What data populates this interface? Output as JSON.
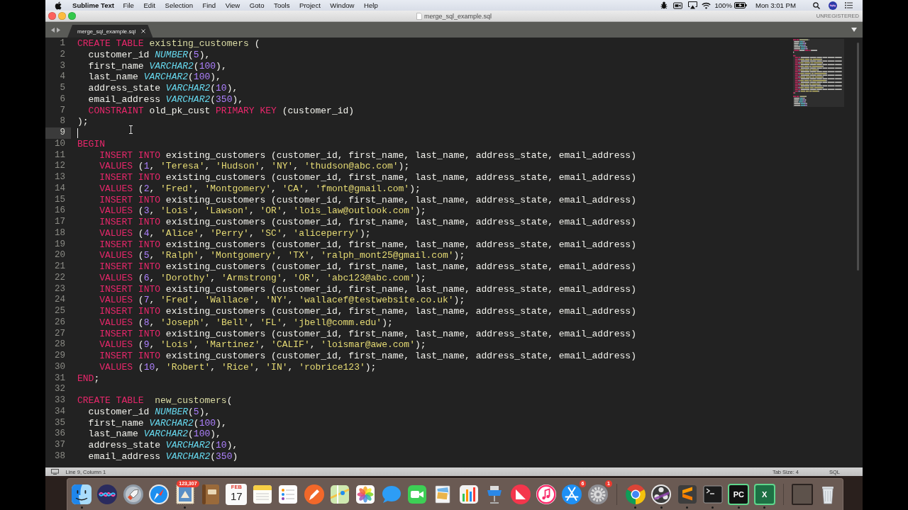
{
  "menu_bar": {
    "app_name": "Sublime Text",
    "menus": [
      "File",
      "Edit",
      "Selection",
      "Find",
      "View",
      "Goto",
      "Tools",
      "Project",
      "Window",
      "Help"
    ],
    "battery_percent": "100%",
    "clock": "Mon 3:01 PM"
  },
  "window": {
    "title": "merge_sql_example.sql",
    "license": "UNREGISTERED"
  },
  "tabs": [
    {
      "label": "merge_sql_example.sql",
      "selected": true
    }
  ],
  "editor": {
    "lines": [
      {
        "number": "1",
        "current": false,
        "tokens": [
          {
            "kind": "keyword",
            "text": "CREATE "
          },
          {
            "kind": "keyword",
            "text": "TABLE "
          },
          {
            "kind": "name",
            "text": "existing_customers"
          },
          {
            "kind": "plain",
            "text": " ("
          }
        ]
      },
      {
        "number": "2",
        "current": false,
        "tokens": [
          {
            "kind": "plain",
            "text": "  customer_id "
          },
          {
            "kind": "type",
            "text": "NUMBER"
          },
          {
            "kind": "plain",
            "text": "("
          },
          {
            "kind": "number",
            "text": "5"
          },
          {
            "kind": "plain",
            "text": "),"
          }
        ]
      },
      {
        "number": "3",
        "current": false,
        "tokens": [
          {
            "kind": "plain",
            "text": "  first_name "
          },
          {
            "kind": "type",
            "text": "VARCHAR2"
          },
          {
            "kind": "plain",
            "text": "("
          },
          {
            "kind": "number",
            "text": "100"
          },
          {
            "kind": "plain",
            "text": "),"
          }
        ]
      },
      {
        "number": "4",
        "current": false,
        "tokens": [
          {
            "kind": "plain",
            "text": "  last_name "
          },
          {
            "kind": "type",
            "text": "VARCHAR2"
          },
          {
            "kind": "plain",
            "text": "("
          },
          {
            "kind": "number",
            "text": "100"
          },
          {
            "kind": "plain",
            "text": "),"
          }
        ]
      },
      {
        "number": "5",
        "current": false,
        "tokens": [
          {
            "kind": "plain",
            "text": "  address_state "
          },
          {
            "kind": "type",
            "text": "VARCHAR2"
          },
          {
            "kind": "plain",
            "text": "("
          },
          {
            "kind": "number",
            "text": "10"
          },
          {
            "kind": "plain",
            "text": "),"
          }
        ]
      },
      {
        "number": "6",
        "current": false,
        "tokens": [
          {
            "kind": "plain",
            "text": "  email_address "
          },
          {
            "kind": "type",
            "text": "VARCHAR2"
          },
          {
            "kind": "plain",
            "text": "("
          },
          {
            "kind": "number",
            "text": "350"
          },
          {
            "kind": "plain",
            "text": "),"
          }
        ]
      },
      {
        "number": "7",
        "current": false,
        "tokens": [
          {
            "kind": "keyword",
            "text": "  CONSTRAINT"
          },
          {
            "kind": "plain",
            "text": " old_pk_cust "
          },
          {
            "kind": "keyword",
            "text": "PRIMARY "
          },
          {
            "kind": "keyword",
            "text": "KEY"
          },
          {
            "kind": "plain",
            "text": " (customer_id)"
          }
        ]
      },
      {
        "number": "8",
        "current": false,
        "tokens": [
          {
            "kind": "plain",
            "text": ");"
          }
        ]
      },
      {
        "number": "9",
        "current": true
      },
      {
        "number": "10",
        "current": false,
        "tokens": [
          {
            "kind": "keyword",
            "text": "BEGIN"
          }
        ]
      },
      {
        "number": "11",
        "current": false,
        "tokens": [
          {
            "kind": "keyword",
            "text": "    INSERT "
          },
          {
            "kind": "keyword",
            "text": "INTO"
          },
          {
            "kind": "plain",
            "text": " existing_customers (customer_id, first_name, last_name, address_state, email_address)"
          }
        ]
      },
      {
        "number": "12",
        "current": false,
        "tokens": [
          {
            "kind": "keyword",
            "text": "    VALUES"
          },
          {
            "kind": "plain",
            "text": " ("
          },
          {
            "kind": "number",
            "text": "1"
          },
          {
            "kind": "plain",
            "text": ", "
          },
          {
            "kind": "string",
            "text": "'Teresa'"
          },
          {
            "kind": "plain",
            "text": ", "
          },
          {
            "kind": "string",
            "text": "'Hudson'"
          },
          {
            "kind": "plain",
            "text": ", "
          },
          {
            "kind": "string",
            "text": "'NY'"
          },
          {
            "kind": "plain",
            "text": ", "
          },
          {
            "kind": "string",
            "text": "'thudson@abc.com'"
          },
          {
            "kind": "plain",
            "text": ");"
          }
        ]
      },
      {
        "number": "13",
        "current": false,
        "tokens": [
          {
            "kind": "keyword",
            "text": "    INSERT "
          },
          {
            "kind": "keyword",
            "text": "INTO"
          },
          {
            "kind": "plain",
            "text": " existing_customers (customer_id, first_name, last_name, address_state, email_address)"
          }
        ]
      },
      {
        "number": "14",
        "current": false,
        "tokens": [
          {
            "kind": "keyword",
            "text": "    VALUES"
          },
          {
            "kind": "plain",
            "text": " ("
          },
          {
            "kind": "number",
            "text": "2"
          },
          {
            "kind": "plain",
            "text": ", "
          },
          {
            "kind": "string",
            "text": "'Fred'"
          },
          {
            "kind": "plain",
            "text": ", "
          },
          {
            "kind": "string",
            "text": "'Montgomery'"
          },
          {
            "kind": "plain",
            "text": ", "
          },
          {
            "kind": "string",
            "text": "'CA'"
          },
          {
            "kind": "plain",
            "text": ", "
          },
          {
            "kind": "string",
            "text": "'fmont@gmail.com'"
          },
          {
            "kind": "plain",
            "text": ");"
          }
        ]
      },
      {
        "number": "15",
        "current": false,
        "tokens": [
          {
            "kind": "keyword",
            "text": "    INSERT "
          },
          {
            "kind": "keyword",
            "text": "INTO"
          },
          {
            "kind": "plain",
            "text": " existing_customers (customer_id, first_name, last_name, address_state, email_address)"
          }
        ]
      },
      {
        "number": "16",
        "current": false,
        "tokens": [
          {
            "kind": "keyword",
            "text": "    VALUES"
          },
          {
            "kind": "plain",
            "text": " ("
          },
          {
            "kind": "number",
            "text": "3"
          },
          {
            "kind": "plain",
            "text": ", "
          },
          {
            "kind": "string",
            "text": "'Lois'"
          },
          {
            "kind": "plain",
            "text": ", "
          },
          {
            "kind": "string",
            "text": "'Lawson'"
          },
          {
            "kind": "plain",
            "text": ", "
          },
          {
            "kind": "string",
            "text": "'OR'"
          },
          {
            "kind": "plain",
            "text": ", "
          },
          {
            "kind": "string",
            "text": "'lois_law@outlook.com'"
          },
          {
            "kind": "plain",
            "text": ");"
          }
        ]
      },
      {
        "number": "17",
        "current": false,
        "tokens": [
          {
            "kind": "keyword",
            "text": "    INSERT "
          },
          {
            "kind": "keyword",
            "text": "INTO"
          },
          {
            "kind": "plain",
            "text": " existing_customers (customer_id, first_name, last_name, address_state, email_address)"
          }
        ]
      },
      {
        "number": "18",
        "current": false,
        "tokens": [
          {
            "kind": "keyword",
            "text": "    VALUES"
          },
          {
            "kind": "plain",
            "text": " ("
          },
          {
            "kind": "number",
            "text": "4"
          },
          {
            "kind": "plain",
            "text": ", "
          },
          {
            "kind": "string",
            "text": "'Alice'"
          },
          {
            "kind": "plain",
            "text": ", "
          },
          {
            "kind": "string",
            "text": "'Perry'"
          },
          {
            "kind": "plain",
            "text": ", "
          },
          {
            "kind": "string",
            "text": "'SC'"
          },
          {
            "kind": "plain",
            "text": ", "
          },
          {
            "kind": "string",
            "text": "'aliceperry'"
          },
          {
            "kind": "plain",
            "text": ");"
          }
        ]
      },
      {
        "number": "19",
        "current": false,
        "tokens": [
          {
            "kind": "keyword",
            "text": "    INSERT "
          },
          {
            "kind": "keyword",
            "text": "INTO"
          },
          {
            "kind": "plain",
            "text": " existing_customers (customer_id, first_name, last_name, address_state, email_address)"
          }
        ]
      },
      {
        "number": "20",
        "current": false,
        "tokens": [
          {
            "kind": "keyword",
            "text": "    VALUES"
          },
          {
            "kind": "plain",
            "text": " ("
          },
          {
            "kind": "number",
            "text": "5"
          },
          {
            "kind": "plain",
            "text": ", "
          },
          {
            "kind": "string",
            "text": "'Ralph'"
          },
          {
            "kind": "plain",
            "text": ", "
          },
          {
            "kind": "string",
            "text": "'Montgomery'"
          },
          {
            "kind": "plain",
            "text": ", "
          },
          {
            "kind": "string",
            "text": "'TX'"
          },
          {
            "kind": "plain",
            "text": ", "
          },
          {
            "kind": "string",
            "text": "'ralph_mont25@gmail.com'"
          },
          {
            "kind": "plain",
            "text": ");"
          }
        ]
      },
      {
        "number": "21",
        "current": false,
        "tokens": [
          {
            "kind": "keyword",
            "text": "    INSERT "
          },
          {
            "kind": "keyword",
            "text": "INTO"
          },
          {
            "kind": "plain",
            "text": " existing_customers (customer_id, first_name, last_name, address_state, email_address)"
          }
        ]
      },
      {
        "number": "22",
        "current": false,
        "tokens": [
          {
            "kind": "keyword",
            "text": "    VALUES"
          },
          {
            "kind": "plain",
            "text": " ("
          },
          {
            "kind": "number",
            "text": "6"
          },
          {
            "kind": "plain",
            "text": ", "
          },
          {
            "kind": "string",
            "text": "'Dorothy'"
          },
          {
            "kind": "plain",
            "text": ", "
          },
          {
            "kind": "string",
            "text": "'Armstrong'"
          },
          {
            "kind": "plain",
            "text": ", "
          },
          {
            "kind": "string",
            "text": "'OR'"
          },
          {
            "kind": "plain",
            "text": ", "
          },
          {
            "kind": "string",
            "text": "'abc123@abc.com'"
          },
          {
            "kind": "plain",
            "text": ");"
          }
        ]
      },
      {
        "number": "23",
        "current": false,
        "tokens": [
          {
            "kind": "keyword",
            "text": "    INSERT "
          },
          {
            "kind": "keyword",
            "text": "INTO"
          },
          {
            "kind": "plain",
            "text": " existing_customers (customer_id, first_name, last_name, address_state, email_address)"
          }
        ]
      },
      {
        "number": "24",
        "current": false,
        "tokens": [
          {
            "kind": "keyword",
            "text": "    VALUES"
          },
          {
            "kind": "plain",
            "text": " ("
          },
          {
            "kind": "number",
            "text": "7"
          },
          {
            "kind": "plain",
            "text": ", "
          },
          {
            "kind": "string",
            "text": "'Fred'"
          },
          {
            "kind": "plain",
            "text": ", "
          },
          {
            "kind": "string",
            "text": "'Wallace'"
          },
          {
            "kind": "plain",
            "text": ", "
          },
          {
            "kind": "string",
            "text": "'NY'"
          },
          {
            "kind": "plain",
            "text": ", "
          },
          {
            "kind": "string",
            "text": "'wallacef@testwebsite.co.uk'"
          },
          {
            "kind": "plain",
            "text": ");"
          }
        ]
      },
      {
        "number": "25",
        "current": false,
        "tokens": [
          {
            "kind": "keyword",
            "text": "    INSERT "
          },
          {
            "kind": "keyword",
            "text": "INTO"
          },
          {
            "kind": "plain",
            "text": " existing_customers (customer_id, first_name, last_name, address_state, email_address)"
          }
        ]
      },
      {
        "number": "26",
        "current": false,
        "tokens": [
          {
            "kind": "keyword",
            "text": "    VALUES"
          },
          {
            "kind": "plain",
            "text": " ("
          },
          {
            "kind": "number",
            "text": "8"
          },
          {
            "kind": "plain",
            "text": ", "
          },
          {
            "kind": "string",
            "text": "'Joseph'"
          },
          {
            "kind": "plain",
            "text": ", "
          },
          {
            "kind": "string",
            "text": "'Bell'"
          },
          {
            "kind": "plain",
            "text": ", "
          },
          {
            "kind": "string",
            "text": "'FL'"
          },
          {
            "kind": "plain",
            "text": ", "
          },
          {
            "kind": "string",
            "text": "'jbell@comm.edu'"
          },
          {
            "kind": "plain",
            "text": ");"
          }
        ]
      },
      {
        "number": "27",
        "current": false,
        "tokens": [
          {
            "kind": "keyword",
            "text": "    INSERT "
          },
          {
            "kind": "keyword",
            "text": "INTO"
          },
          {
            "kind": "plain",
            "text": " existing_customers (customer_id, first_name, last_name, address_state, email_address)"
          }
        ]
      },
      {
        "number": "28",
        "current": false,
        "tokens": [
          {
            "kind": "keyword",
            "text": "    VALUES"
          },
          {
            "kind": "plain",
            "text": " ("
          },
          {
            "kind": "number",
            "text": "9"
          },
          {
            "kind": "plain",
            "text": ", "
          },
          {
            "kind": "string",
            "text": "'Lois'"
          },
          {
            "kind": "plain",
            "text": ", "
          },
          {
            "kind": "string",
            "text": "'Martinez'"
          },
          {
            "kind": "plain",
            "text": ", "
          },
          {
            "kind": "string",
            "text": "'CALIF'"
          },
          {
            "kind": "plain",
            "text": ", "
          },
          {
            "kind": "string",
            "text": "'loismar@awe.com'"
          },
          {
            "kind": "plain",
            "text": ");"
          }
        ]
      },
      {
        "number": "29",
        "current": false,
        "tokens": [
          {
            "kind": "keyword",
            "text": "    INSERT "
          },
          {
            "kind": "keyword",
            "text": "INTO"
          },
          {
            "kind": "plain",
            "text": " existing_customers (customer_id, first_name, last_name, address_state, email_address)"
          }
        ]
      },
      {
        "number": "30",
        "current": false,
        "tokens": [
          {
            "kind": "keyword",
            "text": "    VALUES"
          },
          {
            "kind": "plain",
            "text": " ("
          },
          {
            "kind": "number",
            "text": "10"
          },
          {
            "kind": "plain",
            "text": ", "
          },
          {
            "kind": "string",
            "text": "'Robert'"
          },
          {
            "kind": "plain",
            "text": ", "
          },
          {
            "kind": "string",
            "text": "'Rice'"
          },
          {
            "kind": "plain",
            "text": ", "
          },
          {
            "kind": "string",
            "text": "'IN'"
          },
          {
            "kind": "plain",
            "text": ", "
          },
          {
            "kind": "string",
            "text": "'robrice123'"
          },
          {
            "kind": "plain",
            "text": ");"
          }
        ]
      },
      {
        "number": "31",
        "current": false,
        "tokens": [
          {
            "kind": "keyword",
            "text": "END"
          },
          {
            "kind": "plain",
            "text": ";"
          }
        ]
      },
      {
        "number": "32",
        "current": false
      },
      {
        "number": "33",
        "current": false,
        "tokens": [
          {
            "kind": "keyword",
            "text": "CREATE "
          },
          {
            "kind": "keyword",
            "text": "TABLE  "
          },
          {
            "kind": "name",
            "text": "new_customers"
          },
          {
            "kind": "plain",
            "text": "("
          }
        ]
      },
      {
        "number": "34",
        "current": false,
        "tokens": [
          {
            "kind": "plain",
            "text": "  customer_id "
          },
          {
            "kind": "type",
            "text": "NUMBER"
          },
          {
            "kind": "plain",
            "text": "("
          },
          {
            "kind": "number",
            "text": "5"
          },
          {
            "kind": "plain",
            "text": "),"
          }
        ]
      },
      {
        "number": "35",
        "current": false,
        "tokens": [
          {
            "kind": "plain",
            "text": "  first_name "
          },
          {
            "kind": "type",
            "text": "VARCHAR2"
          },
          {
            "kind": "plain",
            "text": "("
          },
          {
            "kind": "number",
            "text": "100"
          },
          {
            "kind": "plain",
            "text": "),"
          }
        ]
      },
      {
        "number": "36",
        "current": false,
        "tokens": [
          {
            "kind": "plain",
            "text": "  last_name "
          },
          {
            "kind": "type",
            "text": "VARCHAR2"
          },
          {
            "kind": "plain",
            "text": "("
          },
          {
            "kind": "number",
            "text": "100"
          },
          {
            "kind": "plain",
            "text": "),"
          }
        ]
      },
      {
        "number": "37",
        "current": false,
        "tokens": [
          {
            "kind": "plain",
            "text": "  address_state "
          },
          {
            "kind": "type",
            "text": "VARCHAR2"
          },
          {
            "kind": "plain",
            "text": "("
          },
          {
            "kind": "number",
            "text": "10"
          },
          {
            "kind": "plain",
            "text": "),"
          }
        ]
      },
      {
        "number": "38",
        "current": false,
        "tokens": [
          {
            "kind": "plain",
            "text": "  email_address "
          },
          {
            "kind": "type",
            "text": "VARCHAR2"
          },
          {
            "kind": "plain",
            "text": "("
          },
          {
            "kind": "number",
            "text": "350"
          },
          {
            "kind": "plain",
            "text": ")"
          }
        ]
      }
    ]
  },
  "status_bar": {
    "position": "Line 9, Column 1",
    "tab_size": "Tab Size: 4",
    "syntax": "SQL"
  },
  "dock": {
    "sections": [
      {
        "items": [
          {
            "kind": "face",
            "running": true
          },
          {
            "kind": "orb",
            "running": false
          },
          {
            "kind": "rocket",
            "running": false
          },
          {
            "kind": "compass",
            "running": false
          },
          {
            "kind": "stamp",
            "running": true,
            "badge": "123,307"
          },
          {
            "kind": "book",
            "running": false
          },
          {
            "kind": "calendar",
            "running": false,
            "month": "FEB",
            "day": "17"
          },
          {
            "kind": "notepad",
            "running": false
          },
          {
            "kind": "checklist",
            "running": false
          },
          {
            "kind": "brush",
            "running": false
          },
          {
            "kind": "map",
            "running": false
          },
          {
            "kind": "flower",
            "running": false
          },
          {
            "kind": "chat",
            "running": false
          },
          {
            "kind": "camera",
            "running": false
          },
          {
            "kind": "pictures",
            "running": false
          },
          {
            "kind": "chart",
            "running": false
          },
          {
            "kind": "podium",
            "running": false
          },
          {
            "kind": "emblem",
            "running": false
          },
          {
            "kind": "note",
            "running": false
          },
          {
            "kind": "tools",
            "running": false,
            "badge": "6"
          },
          {
            "kind": "gear",
            "running": false,
            "badge": "1"
          }
        ]
      },
      {
        "items": [
          {
            "kind": "tricolor",
            "running": true
          },
          {
            "kind": "reel",
            "running": true
          },
          {
            "kind": "bars",
            "running": true
          },
          {
            "kind": "terminal",
            "running": true
          },
          {
            "kind": "letters",
            "running": true,
            "label": "PC",
            "color": "#111111"
          },
          {
            "kind": "letters",
            "running": true,
            "label": "X",
            "color": "#1d7044"
          }
        ]
      },
      {
        "items": [
          {
            "kind": "thumbnail",
            "running": false
          },
          {
            "kind": "trash",
            "running": false
          }
        ]
      }
    ]
  }
}
